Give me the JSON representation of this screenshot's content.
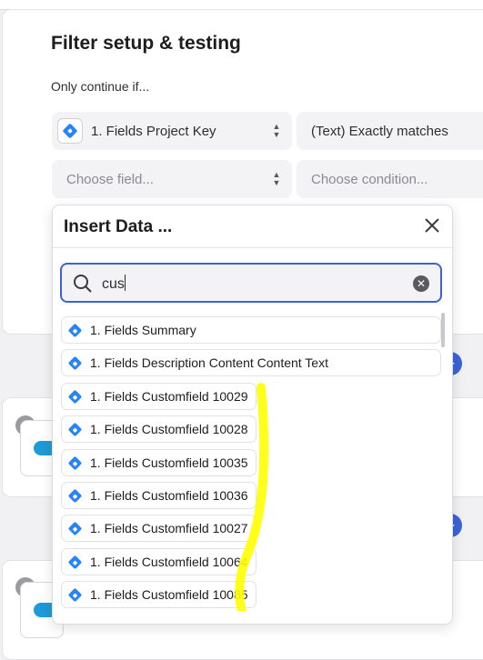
{
  "section": {
    "title": "Filter setup & testing",
    "subtitle": "Only continue if..."
  },
  "rule1": {
    "field_value": "1. Fields Project Key",
    "condition_value": "(Text) Exactly matches"
  },
  "rule2": {
    "field_placeholder": "Choose field...",
    "condition_placeholder": "Choose condition..."
  },
  "dropdown": {
    "title": "Insert Data ...",
    "search_value": "cus",
    "items": [
      {
        "label": "1. Fields Summary"
      },
      {
        "label": "1. Fields Description Content Content Text"
      },
      {
        "label": "1. Fields Customfield 10029"
      },
      {
        "label": "1. Fields Customfield 10028"
      },
      {
        "label": "1. Fields Customfield 10035"
      },
      {
        "label": "1. Fields Customfield 10036"
      },
      {
        "label": "1. Fields Customfield 10027"
      },
      {
        "label": "1. Fields Customfield 10064"
      },
      {
        "label": "1. Fields Customfield 10085"
      }
    ]
  },
  "icons": {
    "app": "jira-icon",
    "search": "search-icon",
    "clear": "clear-icon",
    "close": "close-icon",
    "warning": "warning-icon",
    "salesforce": "salesforce-icon"
  },
  "colors": {
    "accent": "#3b63d9",
    "jira": "#2684ff",
    "annotation": "#ffff00"
  }
}
